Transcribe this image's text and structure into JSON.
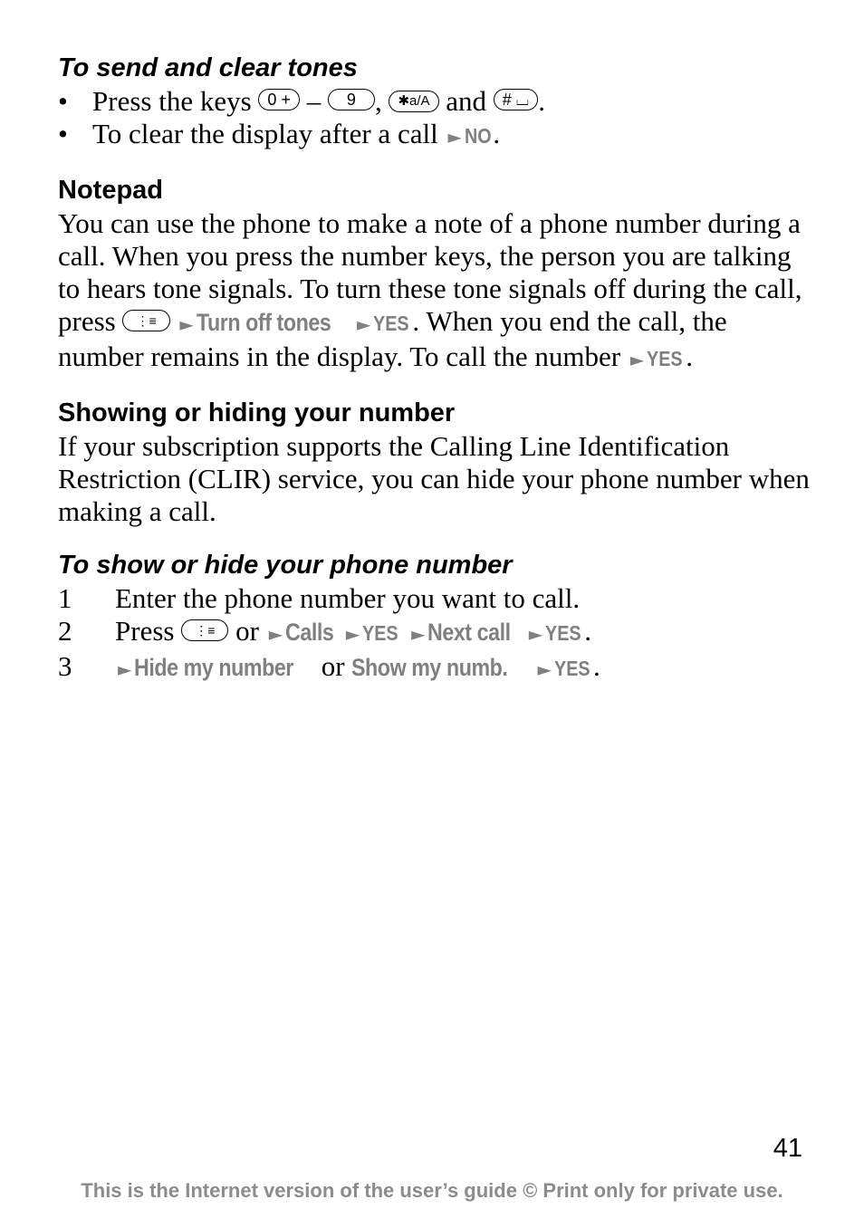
{
  "section_send_tones": {
    "heading": "To send and clear tones",
    "bullet1": {
      "pre": "Press the keys ",
      "key1": "0 +",
      "dash": " – ",
      "key2": "9",
      "comma": ", ",
      "key3": "✱a/A",
      "and": " and ",
      "key4": "# ⌴",
      "end": "."
    },
    "bullet2": {
      "pre": "To clear the display after a call ",
      "menu": "NO",
      "end": "."
    }
  },
  "section_notepad": {
    "heading": "Notepad",
    "text1": "You can use the phone to make a note of a phone number during a call. When you press the number keys, the person you are talking to hears tone signals. To turn these tone signals off during the call, press ",
    "key": "⋮≡",
    "menu1": "Turn off tones",
    "menu2": "YES",
    "text2": ". When you end the call, the number remains in the display. To call the number ",
    "menu3": "YES",
    "end": "."
  },
  "section_show_hide": {
    "heading": "Showing or hiding your number",
    "text": "If your subscription supports the Calling Line Identification Restriction (CLIR) service, you can hide your phone number when making a call."
  },
  "section_steps": {
    "heading": "To show or hide your phone number",
    "steps": [
      {
        "num": "1",
        "text": "Enter the phone number you want to call."
      },
      {
        "num": "2",
        "pre": "Press ",
        "key": "⋮≡",
        "or": " or ",
        "m1": "Calls",
        "m2": "YES",
        "m3": "Next call",
        "m4": "YES",
        "end": "."
      },
      {
        "num": "3",
        "m1": "Hide my number",
        "or": " or ",
        "m2": "Show my numb.",
        "m3": "YES",
        "end": "."
      }
    ]
  },
  "arrow_glyph": "►",
  "page_number": "41",
  "footer": "This is the Internet version of the user’s guide © Print only for private use."
}
